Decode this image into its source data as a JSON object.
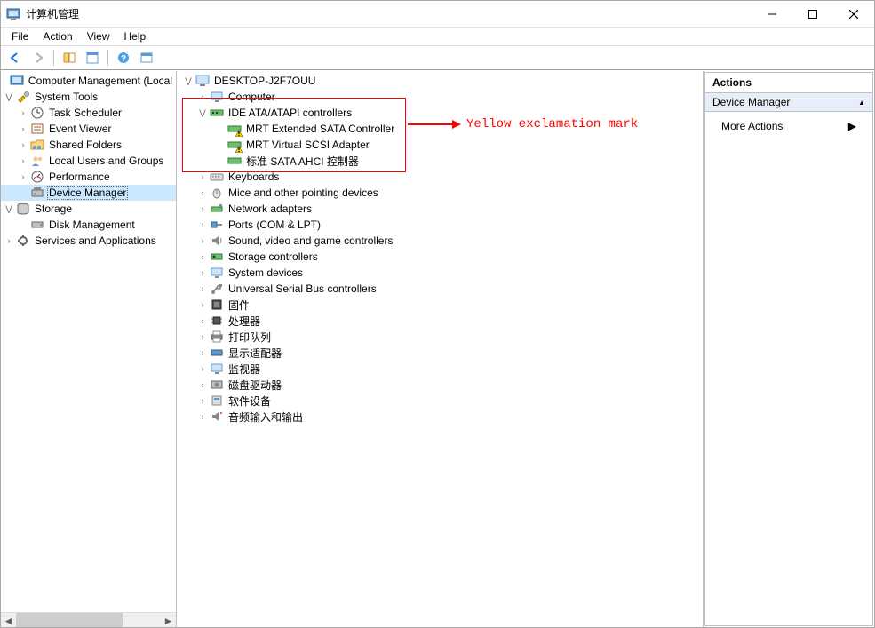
{
  "window": {
    "title": "计算机管理"
  },
  "menu": {
    "file": "File",
    "action": "Action",
    "view": "View",
    "help": "Help"
  },
  "left_tree": {
    "root": "Computer Management (Local",
    "system_tools": "System Tools",
    "task_scheduler": "Task Scheduler",
    "event_viewer": "Event Viewer",
    "shared_folders": "Shared Folders",
    "local_users": "Local Users and Groups",
    "performance": "Performance",
    "device_manager": "Device Manager",
    "storage": "Storage",
    "disk_management": "Disk Management",
    "services_apps": "Services and Applications"
  },
  "device_tree": {
    "root": "DESKTOP-J2F7OUU",
    "computer": "Computer",
    "ide": "IDE ATA/ATAPI controllers",
    "ide_children": {
      "mrt_sata": "MRT Extended SATA Controller",
      "mrt_scsi": "MRT Virtual SCSI Adapter",
      "std_ahci": "标准 SATA AHCI 控制器"
    },
    "keyboards": "Keyboards",
    "mice": "Mice and other pointing devices",
    "network": "Network adapters",
    "ports": "Ports (COM & LPT)",
    "sound": "Sound, video and game controllers",
    "storage_ctrl": "Storage controllers",
    "system_devices": "System devices",
    "usb": "Universal Serial Bus controllers",
    "firmware": "固件",
    "processors": "处理器",
    "print_queues": "打印队列",
    "display": "显示适配器",
    "monitors": "监视器",
    "disk_drives": "磁盘驱动器",
    "software_devices": "软件设备",
    "audio_io": "音频输入和输出"
  },
  "actions": {
    "header": "Actions",
    "section": "Device Manager",
    "more": "More Actions"
  },
  "annotation": {
    "text": "Yellow exclamation mark"
  }
}
